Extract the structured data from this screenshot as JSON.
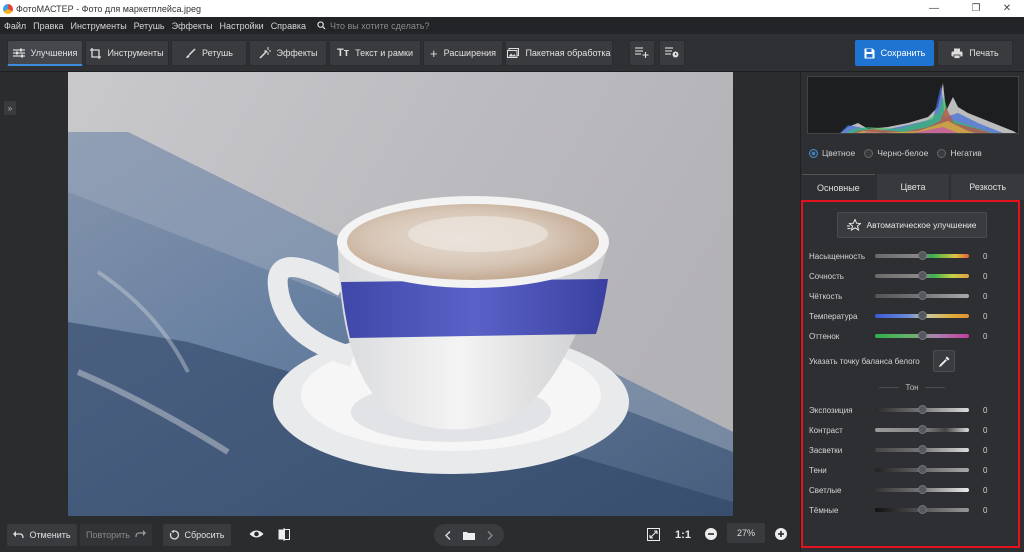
{
  "window": {
    "title": "ФотоМАСТЕР - Фото для маркетплейса.jpeg",
    "controls": [
      "minimize-icon",
      "restore-icon",
      "close-icon"
    ]
  },
  "menu": {
    "items": [
      "Файл",
      "Правка",
      "Инструменты",
      "Ретушь",
      "Эффекты",
      "Настройки",
      "Справка"
    ],
    "search_placeholder": "Что вы хотите сделать?"
  },
  "toolbar": {
    "enhance": "Улучшения",
    "tools": "Инструменты",
    "retouch": "Ретушь",
    "effects": "Эффекты",
    "text": "Текст и рамки",
    "extensions": "Расширения",
    "batch": "Пакетная обработка",
    "save": "Сохранить",
    "print": "Печать",
    "accent_color": "#1f73d1"
  },
  "bottom": {
    "undo": "Отменить",
    "redo": "Повторить",
    "reset": "Сбросить",
    "ratio": "1:1",
    "zoom": "27%"
  },
  "panel": {
    "modes": [
      {
        "label": "Цветное",
        "selected": true
      },
      {
        "label": "Черно-белое",
        "selected": false
      },
      {
        "label": "Негатив",
        "selected": false
      }
    ],
    "tabs": [
      {
        "label": "Основные",
        "active": true
      },
      {
        "label": "Цвета",
        "active": false
      },
      {
        "label": "Резкость",
        "active": false
      }
    ],
    "auto_button": "Автоматическое улучшение",
    "sliders_main": [
      {
        "label": "Насыщенность",
        "value": "0"
      },
      {
        "label": "Сочность",
        "value": "0"
      },
      {
        "label": "Чёткость",
        "value": "0"
      },
      {
        "label": "Температура",
        "value": "0"
      },
      {
        "label": "Оттенок",
        "value": "0"
      }
    ],
    "white_balance_label": "Указать точку баланса белого",
    "tone_header": "Тон",
    "sliders_tone": [
      {
        "label": "Экспозиция",
        "value": "0"
      },
      {
        "label": "Контраст",
        "value": "0"
      },
      {
        "label": "Засветки",
        "value": "0"
      },
      {
        "label": "Тени",
        "value": "0"
      },
      {
        "label": "Светлые",
        "value": "0"
      },
      {
        "label": "Тёмные",
        "value": "0"
      }
    ],
    "highlight_color": "#e3121d"
  }
}
